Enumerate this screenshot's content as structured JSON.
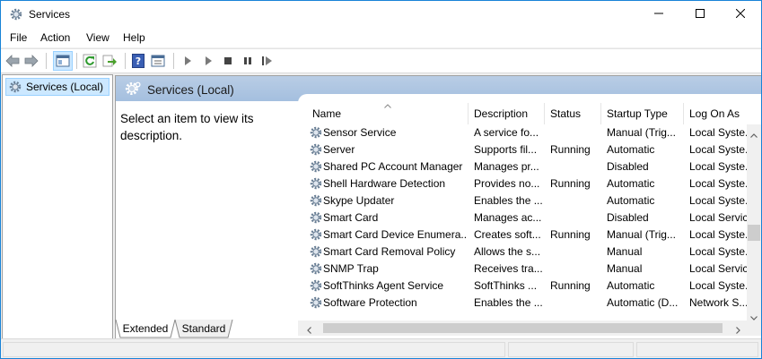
{
  "window": {
    "title": "Services",
    "icons": {
      "app": "gear-icon",
      "minimize": "minimize-icon",
      "maximize": "maximize-icon",
      "close": "close-icon"
    }
  },
  "menu": [
    "File",
    "Action",
    "View",
    "Help"
  ],
  "toolbar": {
    "icons": [
      "back-arrow-icon",
      "forward-arrow-icon",
      "show-hide-console-tree-icon",
      "refresh-icon",
      "export-list-icon",
      "help-icon",
      "properties-icon",
      "start-service-icon",
      "start-service-alt-icon",
      "stop-service-icon",
      "pause-service-icon",
      "restart-service-icon"
    ]
  },
  "tree": {
    "item": "Services (Local)"
  },
  "content": {
    "header": "Services (Local)",
    "description": "Select an item to view its description."
  },
  "table": {
    "columns": [
      "Name",
      "Description",
      "Status",
      "Startup Type",
      "Log On As"
    ],
    "rows": [
      [
        "Sensor Service",
        "A service fo...",
        "",
        "Manual (Trig...",
        "Local Syste..."
      ],
      [
        "Server",
        "Supports fil...",
        "Running",
        "Automatic",
        "Local Syste..."
      ],
      [
        "Shared PC Account Manager",
        "Manages pr...",
        "",
        "Disabled",
        "Local Syste..."
      ],
      [
        "Shell Hardware Detection",
        "Provides no...",
        "Running",
        "Automatic",
        "Local Syste..."
      ],
      [
        "Skype Updater",
        "Enables the ...",
        "",
        "Automatic",
        "Local Syste..."
      ],
      [
        "Smart Card",
        "Manages ac...",
        "",
        "Disabled",
        "Local Servic"
      ],
      [
        "Smart Card Device Enumera...",
        "Creates soft...",
        "Running",
        "Manual (Trig...",
        "Local Syste..."
      ],
      [
        "Smart Card Removal Policy",
        "Allows the s...",
        "",
        "Manual",
        "Local Syste..."
      ],
      [
        "SNMP Trap",
        "Receives tra...",
        "",
        "Manual",
        "Local Servic"
      ],
      [
        "SoftThinks Agent Service",
        "SoftThinks ...",
        "Running",
        "Automatic",
        "Local Syste..."
      ],
      [
        "Software Protection",
        "Enables the ...",
        "",
        "Automatic (D...",
        "Network S..."
      ]
    ]
  },
  "tabs": [
    "Extended",
    "Standard"
  ],
  "colors": {
    "selection": "#cce8ff",
    "header_bar": "#a4bfdf",
    "window_border": "#1883d7"
  }
}
